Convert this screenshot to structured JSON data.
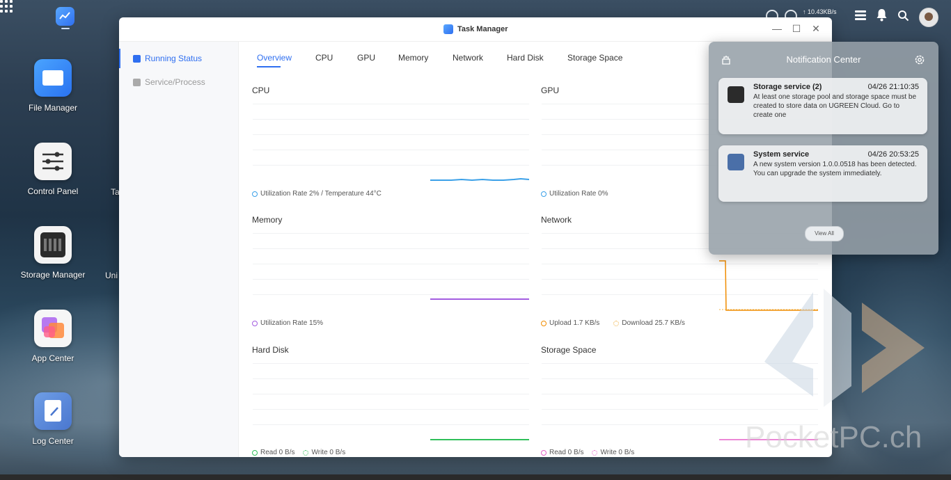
{
  "topbar": {
    "net_speed": "↑ 10.43KB/s"
  },
  "desktop": {
    "icons": [
      {
        "label": "File Manager"
      },
      {
        "label": "Control Panel"
      },
      {
        "label": "Storage Manager"
      },
      {
        "label": "App Center"
      },
      {
        "label": "Log Center"
      }
    ],
    "partial_labels": [
      "Ta",
      "Uni"
    ]
  },
  "window": {
    "title": "Task Manager",
    "sidebar": [
      {
        "label": "Running Status",
        "active": true
      },
      {
        "label": "Service/Process",
        "active": false
      }
    ],
    "tabs": [
      {
        "label": "Overview",
        "active": true
      },
      {
        "label": "CPU"
      },
      {
        "label": "GPU"
      },
      {
        "label": "Memory"
      },
      {
        "label": "Network"
      },
      {
        "label": "Hard Disk"
      },
      {
        "label": "Storage Space"
      }
    ],
    "panels": {
      "cpu": {
        "title": "CPU",
        "legend": "Utilization Rate 2% / Temperature 44°C"
      },
      "gpu": {
        "title": "GPU",
        "legend": "Utilization Rate 0%"
      },
      "memory": {
        "title": "Memory",
        "legend": "Utilization Rate 15%"
      },
      "network": {
        "title": "Network",
        "legend_upload": "Upload 1.7 KB/s",
        "legend_download": "Download 25.7 KB/s"
      },
      "hard_disk": {
        "title": "Hard Disk",
        "legend_read": "Read 0 B/s",
        "legend_write": "Write 0 B/s"
      },
      "storage_space": {
        "title": "Storage Space",
        "legend_read": "Read 0 B/s",
        "legend_write": "Write 0 B/s"
      }
    }
  },
  "notification_center": {
    "title": "Notification Center",
    "notifications": [
      {
        "title": "Storage service (2)",
        "time": "04/26 21:10:35",
        "body": "At least one storage pool and storage space must be created to store data on UGREEN Cloud. Go to create one"
      },
      {
        "title": "System service",
        "time": "04/26 20:53:25",
        "body": "A new system version 1.0.0.0518 has been detected. You can upgrade the system immediately."
      }
    ],
    "view_all": "View All"
  },
  "watermark": "PocketPC.ch",
  "colors": {
    "accent": "#2f6ff0",
    "cpu": "#3aa0e8",
    "memory": "#a35ce0",
    "network_upload": "#f08c00",
    "network_download": "#f0b040",
    "disk_read": "#2fbf5a",
    "storage_write": "#e660c8"
  }
}
